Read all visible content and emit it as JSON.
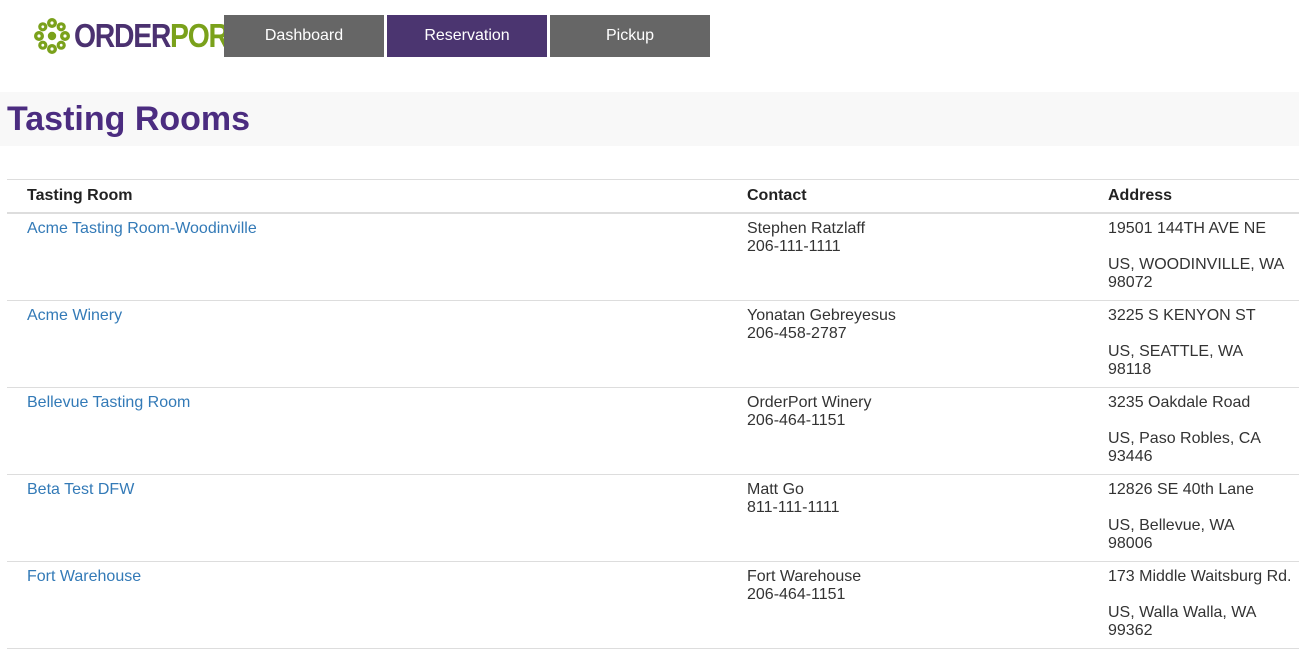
{
  "logo": {
    "text_order": "ORDER",
    "text_port": "PORT",
    "icon": "flower-logo-icon",
    "colors": {
      "order": "#4b3170",
      "port": "#7aa11b"
    }
  },
  "nav": {
    "items": [
      {
        "label": "Dashboard",
        "active": false
      },
      {
        "label": "Reservation",
        "active": true
      },
      {
        "label": "Pickup",
        "active": false
      }
    ],
    "colors": {
      "default": "#666666",
      "active": "#4b3570"
    }
  },
  "page": {
    "title": "Tasting Rooms",
    "title_color": "#4b2c80",
    "link_color": "#337ab7"
  },
  "table": {
    "headers": {
      "room": "Tasting Room",
      "contact": "Contact",
      "address": "Address"
    },
    "rows": [
      {
        "room": "Acme Tasting Room-Woodinville",
        "contact_name": "Stephen Ratzlaff",
        "contact_phone": "206-111-1111",
        "street": "19501 144TH AVE NE",
        "city_line": "US, WOODINVILLE, WA",
        "zip": "98072"
      },
      {
        "room": "Acme Winery",
        "contact_name": "Yonatan Gebreyesus",
        "contact_phone": "206-458-2787",
        "street": "3225 S KENYON ST",
        "city_line": "US, SEATTLE, WA",
        "zip": "98118"
      },
      {
        "room": "Bellevue Tasting Room",
        "contact_name": "OrderPort Winery",
        "contact_phone": "206-464-1151",
        "street": "3235 Oakdale Road",
        "city_line": "US, Paso Robles, CA",
        "zip": "93446"
      },
      {
        "room": "Beta Test DFW",
        "contact_name": "Matt Go",
        "contact_phone": "811-111-1111",
        "street": "12826 SE 40th Lane",
        "city_line": "US, Bellevue, WA",
        "zip": "98006"
      },
      {
        "room": "Fort Warehouse",
        "contact_name": "Fort Warehouse",
        "contact_phone": "206-464-1151",
        "street": "173 Middle Waitsburg Rd.",
        "city_line": "US, Walla Walla, WA",
        "zip": "99362"
      }
    ]
  }
}
